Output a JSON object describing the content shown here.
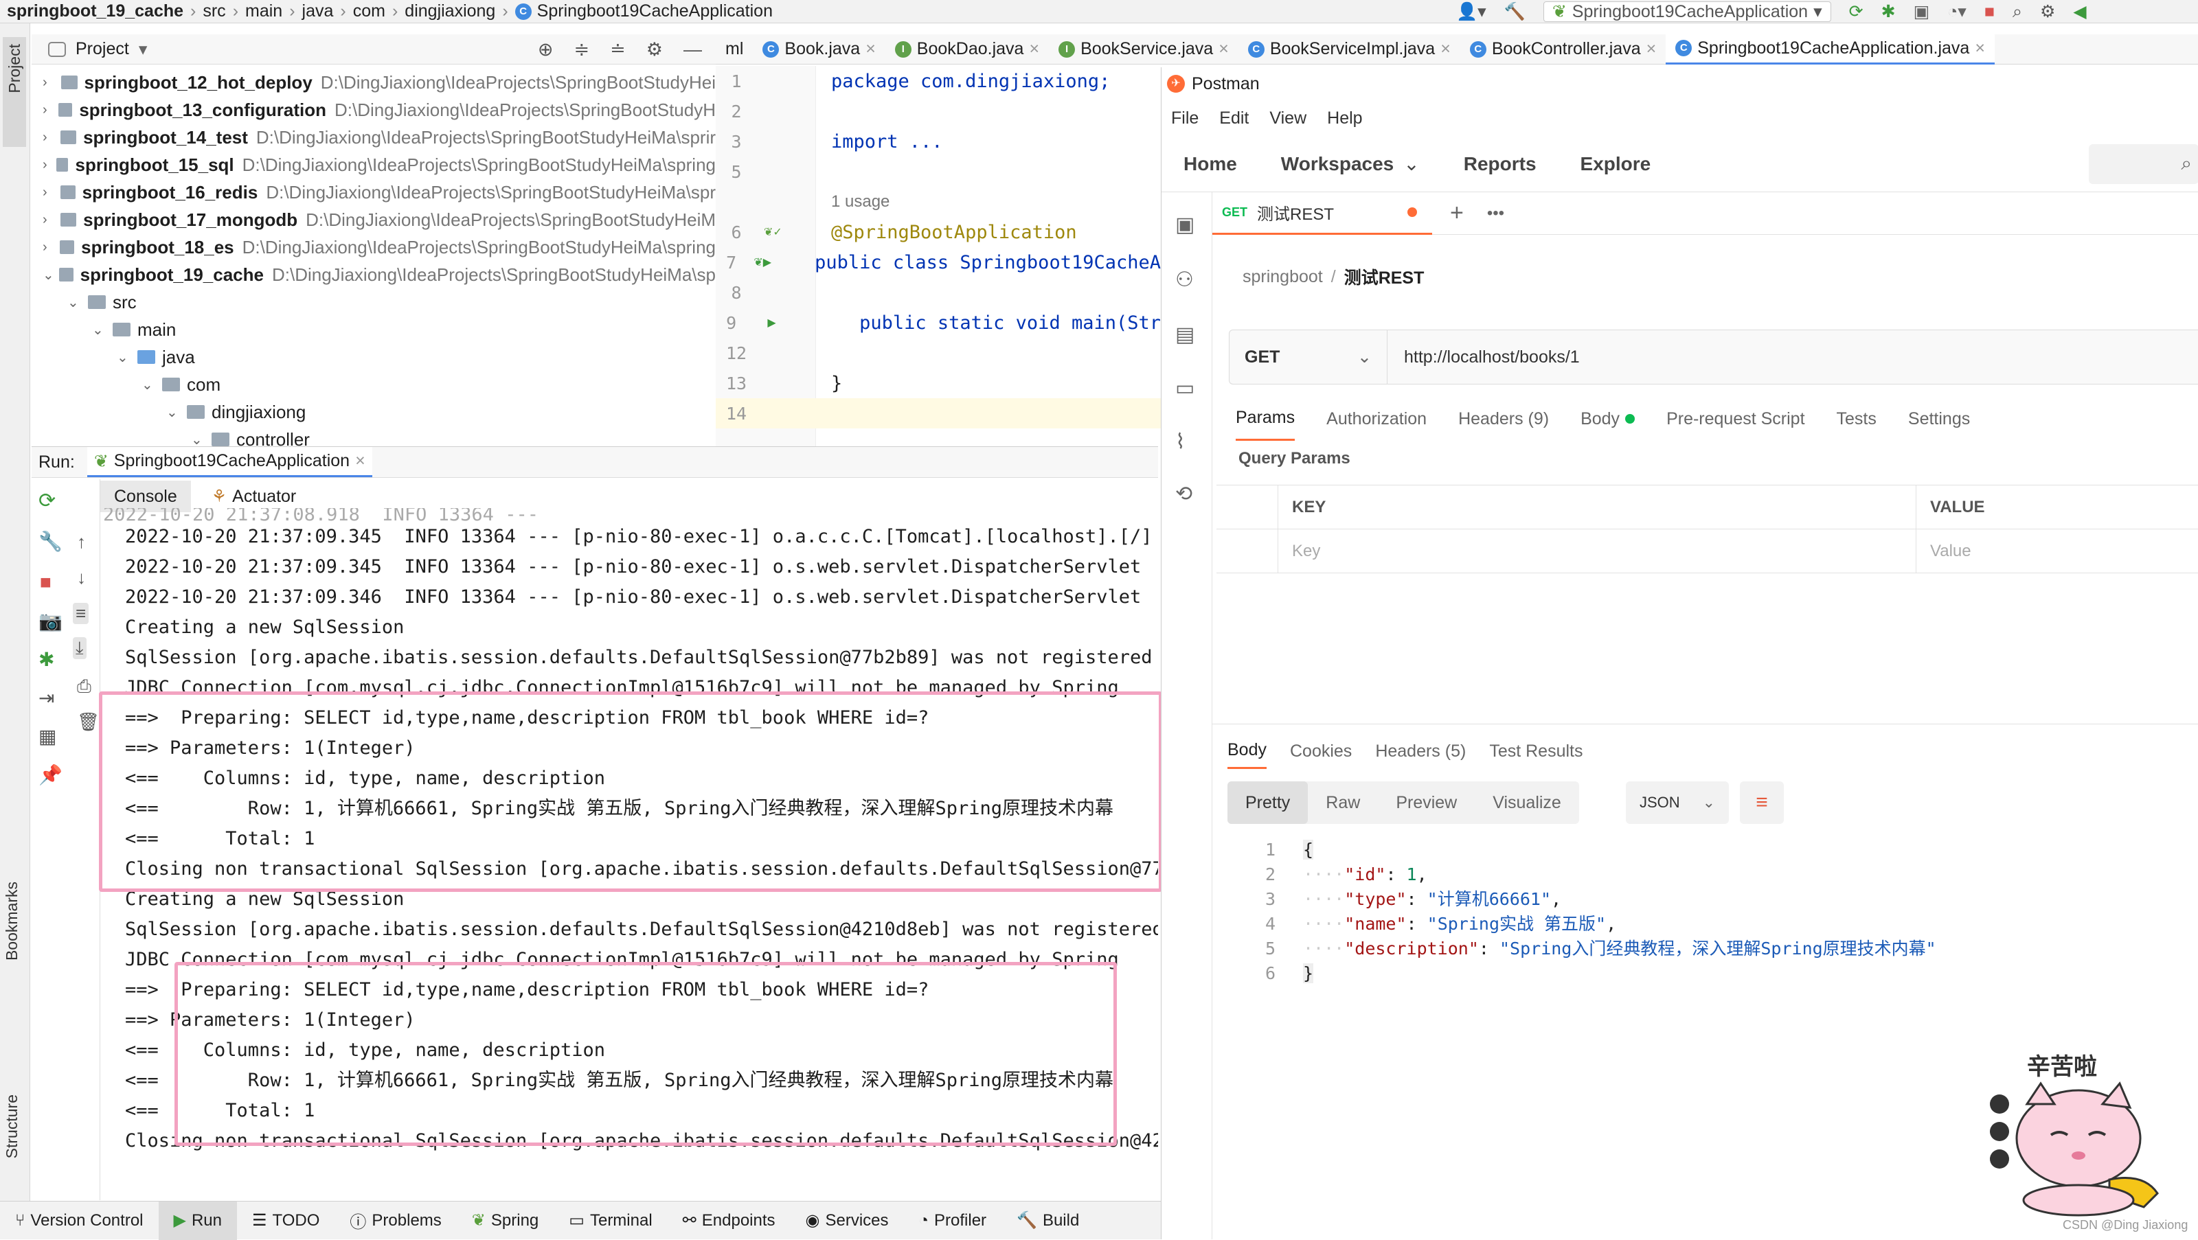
{
  "navbar": {
    "crumbs": [
      "springboot_19_cache",
      "src",
      "main",
      "java",
      "com",
      "dingjiaxiong",
      "Springboot19CacheApplication"
    ],
    "run_config": "Springboot19CacheApplication"
  },
  "project_panel": {
    "title": "Project",
    "tree": [
      {
        "name": "springboot_12_hot_deploy",
        "path": "D:\\DingJiaxiong\\IdeaProjects\\SpringBootStudyHei"
      },
      {
        "name": "springboot_13_configuration",
        "path": "D:\\DingJiaxiong\\IdeaProjects\\SpringBootStudyH"
      },
      {
        "name": "springboot_14_test",
        "path": "D:\\DingJiaxiong\\IdeaProjects\\SpringBootStudyHeiMa\\sprir"
      },
      {
        "name": "springboot_15_sql",
        "path": "D:\\DingJiaxiong\\IdeaProjects\\SpringBootStudyHeiMa\\spring"
      },
      {
        "name": "springboot_16_redis",
        "path": "D:\\DingJiaxiong\\IdeaProjects\\SpringBootStudyHeiMa\\spr"
      },
      {
        "name": "springboot_17_mongodb",
        "path": "D:\\DingJiaxiong\\IdeaProjects\\SpringBootStudyHeiM"
      },
      {
        "name": "springboot_18_es",
        "path": "D:\\DingJiaxiong\\IdeaProjects\\SpringBootStudyHeiMa\\spring"
      },
      {
        "name": "springboot_19_cache",
        "path": "D:\\DingJiaxiong\\IdeaProjects\\SpringBootStudyHeiMa\\sp"
      }
    ],
    "sub": [
      "src",
      "main",
      "java",
      "com",
      "dingjiaxiong",
      "controller"
    ]
  },
  "editor": {
    "tabs": [
      "ml",
      "Book.java",
      "BookDao.java",
      "BookService.java",
      "BookServiceImpl.java",
      "BookController.java",
      "Springboot19CacheApplication.java"
    ],
    "line_numbers": [
      "1",
      "2",
      "3",
      "5",
      "",
      "6",
      "7",
      "8",
      "9",
      "12",
      "13",
      "14"
    ],
    "lines": [
      "package com.dingjiaxiong;",
      "",
      "import ...",
      "",
      "1 usage",
      "@SpringBootApplication",
      "public class Springboot19CacheA",
      "",
      "    public static void main(Str",
      "",
      "}",
      ""
    ]
  },
  "run": {
    "label": "Run:",
    "config": "Springboot19CacheApplication",
    "tabs": [
      "Console",
      "Actuator"
    ],
    "log": [
      "2022-10-20 21:37:09.345  INFO 13364 --- [p-nio-80-exec-1] o.a.c.c.C.[Tomcat].[localhost].[/]",
      "2022-10-20 21:37:09.345  INFO 13364 --- [p-nio-80-exec-1] o.s.web.servlet.DispatcherServlet",
      "2022-10-20 21:37:09.346  INFO 13364 --- [p-nio-80-exec-1] o.s.web.servlet.DispatcherServlet",
      "Creating a new SqlSession",
      "SqlSession [org.apache.ibatis.session.defaults.DefaultSqlSession@77b2b89] was not registered fo",
      "JDBC Connection [com.mysql.cj.jdbc.ConnectionImpl@1516b7c9] will not be managed by Spring",
      "==>  Preparing: SELECT id,type,name,description FROM tbl_book WHERE id=?",
      "==> Parameters: 1(Integer)",
      "<==    Columns: id, type, name, description",
      "<==        Row: 1, 计算机66661, Spring实战 第五版, Spring入门经典教程，深入理解Spring原理技术内幕",
      "<==      Total: 1",
      "Closing non transactional SqlSession [org.apache.ibatis.session.defaults.DefaultSqlSession@77b",
      "Creating a new SqlSession",
      "SqlSession [org.apache.ibatis.session.defaults.DefaultSqlSession@4210d8eb] was not registered f",
      "JDBC Connection [com.mysql.cj.jdbc.ConnectionImpl@1516b7c9] will not be managed by Spring",
      "==>  Preparing: SELECT id,type,name,description FROM tbl_book WHERE id=?",
      "==> Parameters: 1(Integer)",
      "<==    Columns: id, type, name, description",
      "<==        Row: 1, 计算机66661, Spring实战 第五版, Spring入门经典教程，深入理解Spring原理技术内幕",
      "<==      Total: 1",
      "Closing non transactional SqlSession [org.apache.ibatis.session.defaults.DefaultSqlSession@421"
    ]
  },
  "bottom_tools": [
    "Version Control",
    "Run",
    "TODO",
    "Problems",
    "Spring",
    "Terminal",
    "Endpoints",
    "Services",
    "Profiler",
    "Build"
  ],
  "side_labels": {
    "project": "Project",
    "bookmarks": "Bookmarks",
    "structure": "Structure"
  },
  "postman": {
    "title": "Postman",
    "menu": [
      "File",
      "Edit",
      "View",
      "Help"
    ],
    "nav": [
      "Home",
      "Workspaces",
      "Reports",
      "Explore"
    ],
    "tab_method": "GET",
    "tab_name": "测试REST",
    "breadcrumb_collection": "springboot",
    "breadcrumb_request": "测试REST",
    "method": "GET",
    "url": "http://localhost/books/1",
    "req_tabs": [
      "Params",
      "Authorization",
      "Headers (9)",
      "Body",
      "Pre-request Script",
      "Tests",
      "Settings"
    ],
    "query_params_title": "Query Params",
    "col_key": "KEY",
    "col_value": "VALUE",
    "key_placeholder": "Key",
    "value_placeholder": "Value",
    "resp_tabs": [
      "Body",
      "Cookies",
      "Headers (5)",
      "Test Results"
    ],
    "view_modes": [
      "Pretty",
      "Raw",
      "Preview",
      "Visualize"
    ],
    "format": "JSON",
    "response_lines": [
      "1",
      "2",
      "3",
      "4",
      "5",
      "6"
    ],
    "response": {
      "id": "1",
      "type": "\"计算机66661\"",
      "name": "\"Spring实战 第五版\"",
      "description": "\"Spring入门经典教程，深入理解Spring原理技术内幕\""
    },
    "sticker_text": "辛苦啦",
    "watermark": "CSDN @Ding Jiaxiong"
  }
}
